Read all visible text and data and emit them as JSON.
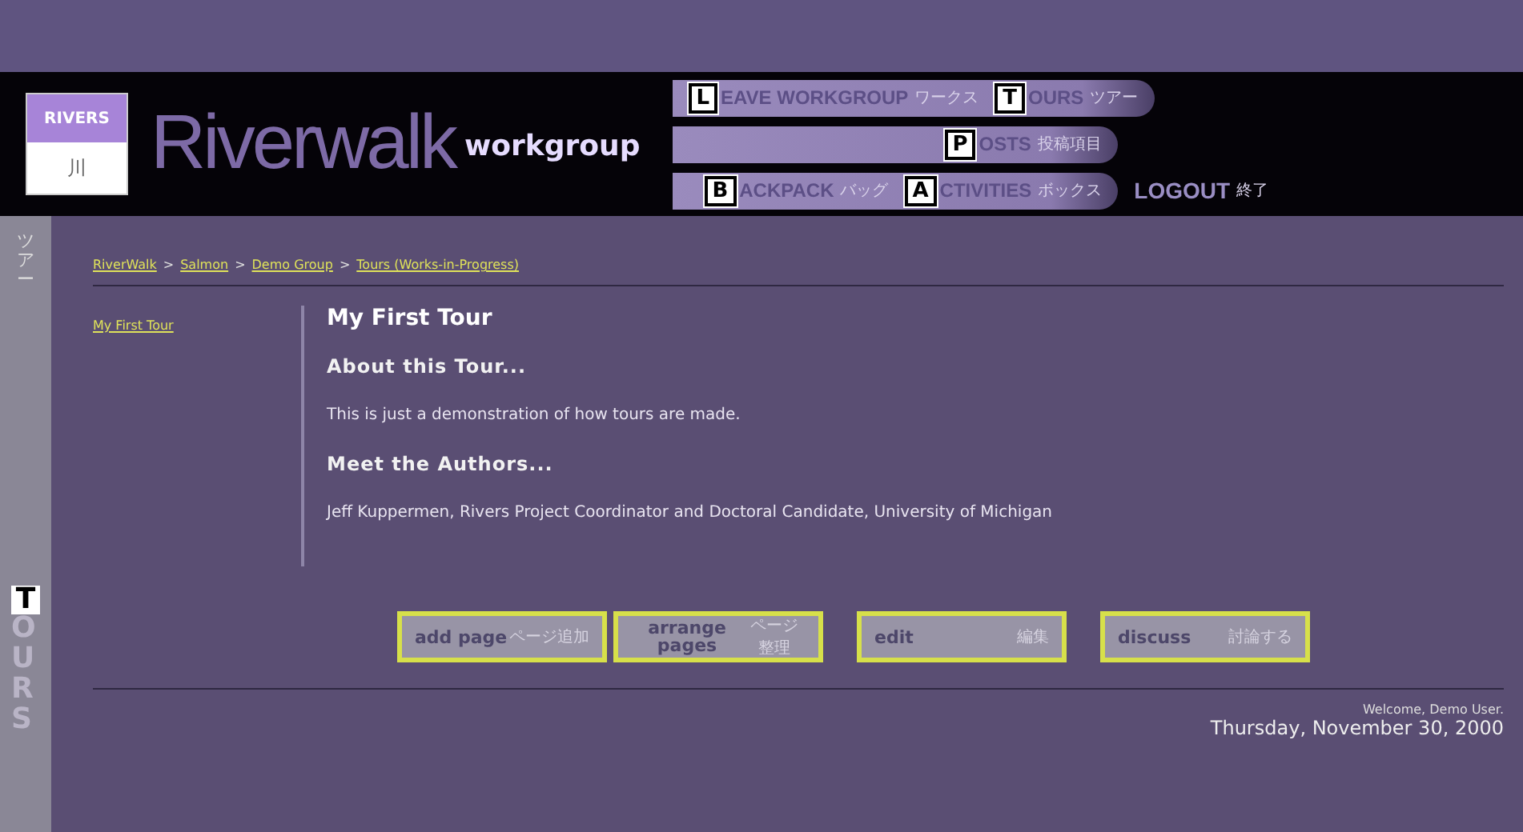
{
  "logo": {
    "top": "RIVERS",
    "bottom": "川"
  },
  "brand": {
    "title": "Riverwalk",
    "subtitle": "workgroup"
  },
  "nav_rows": [
    [
      {
        "initial": "L",
        "rest": "EAVE WORKGROUP",
        "jp": "ワークス"
      },
      {
        "initial": "T",
        "rest": "OURS",
        "jp": "ツアー"
      }
    ],
    [
      {
        "initial": "P",
        "rest": "OSTS",
        "jp": "投稿項目"
      }
    ],
    [
      {
        "initial": "B",
        "rest": "ACKPACK",
        "jp": "バッグ"
      },
      {
        "initial": "A",
        "rest": "CTIVITIES",
        "jp": "ボックス"
      }
    ]
  ],
  "logout": {
    "label": "LOGOUT",
    "jp": "終了"
  },
  "side_tab": {
    "jp": "ツアー",
    "initial": "T",
    "rest": "OURS"
  },
  "breadcrumb": [
    "RiverWalk",
    "Salmon",
    "Demo Group",
    "Tours (Works-in-Progress)"
  ],
  "breadcrumb_separator": ">",
  "tour_list": [
    {
      "label": "My First Tour"
    }
  ],
  "tour": {
    "title": "My First Tour",
    "sections": [
      {
        "heading": "About this Tour...",
        "body": "This is just a demonstration of how tours are made."
      },
      {
        "heading": "Meet the Authors...",
        "body": "Jeff Kuppermen, Rivers Project Coordinator and Doctoral Candidate, University of Michigan"
      }
    ]
  },
  "actions": [
    {
      "label": "add page",
      "jp": "ページ追加"
    },
    {
      "label": "arrange pages",
      "jp": "ページ整理"
    },
    {
      "label": "edit",
      "jp": "編集"
    },
    {
      "label": "discuss",
      "jp": "討論する"
    }
  ],
  "footer": {
    "welcome": "Welcome, Demo User.",
    "date": "Thursday, November 30, 2000"
  }
}
